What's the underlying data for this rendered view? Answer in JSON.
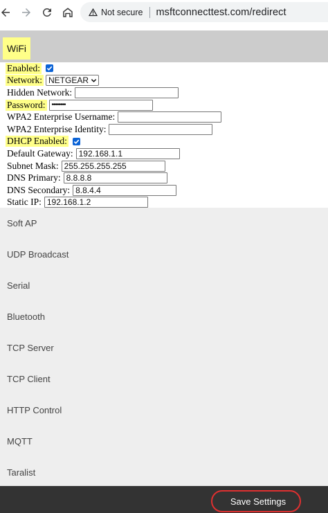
{
  "browser": {
    "security_label": "Not secure",
    "url": "msftconnecttest.com/redirect"
  },
  "header": {
    "title": "WiFi"
  },
  "form": {
    "enabled_label": "Enabled:",
    "enabled_checked": true,
    "network_label": "Network:",
    "network_value": "NETGEAR",
    "hidden_network_label": "Hidden Network:",
    "hidden_network_value": "",
    "password_label": "Password:",
    "password_value": "••••••••",
    "wpa2_username_label": "WPA2 Enterprise Username:",
    "wpa2_username_value": "",
    "wpa2_identity_label": "WPA2 Enterprise Identity:",
    "wpa2_identity_value": "",
    "dhcp_label": "DHCP Enabled:",
    "dhcp_checked": true,
    "gateway_label": "Default Gateway:",
    "gateway_value": "192.168.1.1",
    "subnet_label": "Subnet Mask:",
    "subnet_value": "255.255.255.255",
    "dns_primary_label": "DNS Primary:",
    "dns_primary_value": "8.8.8.8",
    "dns_secondary_label": "DNS Secondary:",
    "dns_secondary_value": "8.8.4.4",
    "static_ip_label": "Static IP:",
    "static_ip_value": "192.168.1.2"
  },
  "sections": [
    "Soft AP",
    "UDP Broadcast",
    "Serial",
    "Bluetooth",
    "TCP Server",
    "TCP Client",
    "HTTP Control",
    "MQTT",
    "Taralist"
  ],
  "footer": {
    "save_label": "Save Settings"
  },
  "colors": {
    "highlight": "#ffff88",
    "header_bg": "#cccccc",
    "sections_bg": "#eeeeee",
    "footer_bg": "#333333",
    "checkbox": "#0b63d6",
    "annotation_ring": "#e03030"
  },
  "icons": [
    "back-arrow-icon",
    "forward-arrow-icon",
    "reload-icon",
    "home-icon",
    "warning-triangle-icon",
    "checkmark-icon",
    "chevron-down-icon"
  ]
}
